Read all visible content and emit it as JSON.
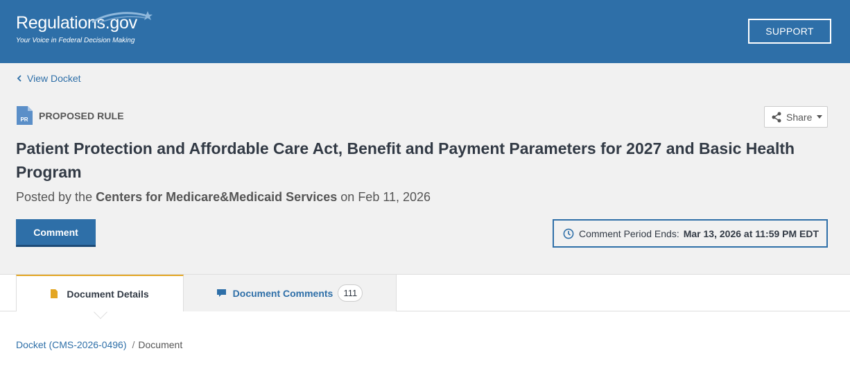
{
  "header": {
    "logo_title": "Regulations.gov",
    "logo_tagline": "Your Voice in Federal Decision Making",
    "support_label": "SUPPORT",
    "background_color": "#2e6fa8"
  },
  "nav": {
    "back_label": "View Docket"
  },
  "document": {
    "type_badge": "PR",
    "type_label": "PROPOSED RULE",
    "title": "Patient Protection and Affordable Care Act, Benefit and Payment Parameters for 2027 and Basic Health Program",
    "posted_prefix": "Posted by the",
    "agency": "Centers for Medicare&Medicaid Services",
    "posted_on": "on",
    "posted_date": "Feb 11, 2026"
  },
  "actions": {
    "share_label": "Share",
    "comment_label": "Comment",
    "period_label": "Comment Period Ends:",
    "period_value": "Mar 13, 2026 at 11:59 PM EDT"
  },
  "tabs": {
    "details_label": "Document Details",
    "comments_label": "Document Comments",
    "comments_count": "111",
    "active_accent": "#e3a623"
  },
  "breadcrumb": {
    "docket_link": "Docket (CMS-2026-0496)",
    "separator": "/",
    "current": "Document"
  }
}
